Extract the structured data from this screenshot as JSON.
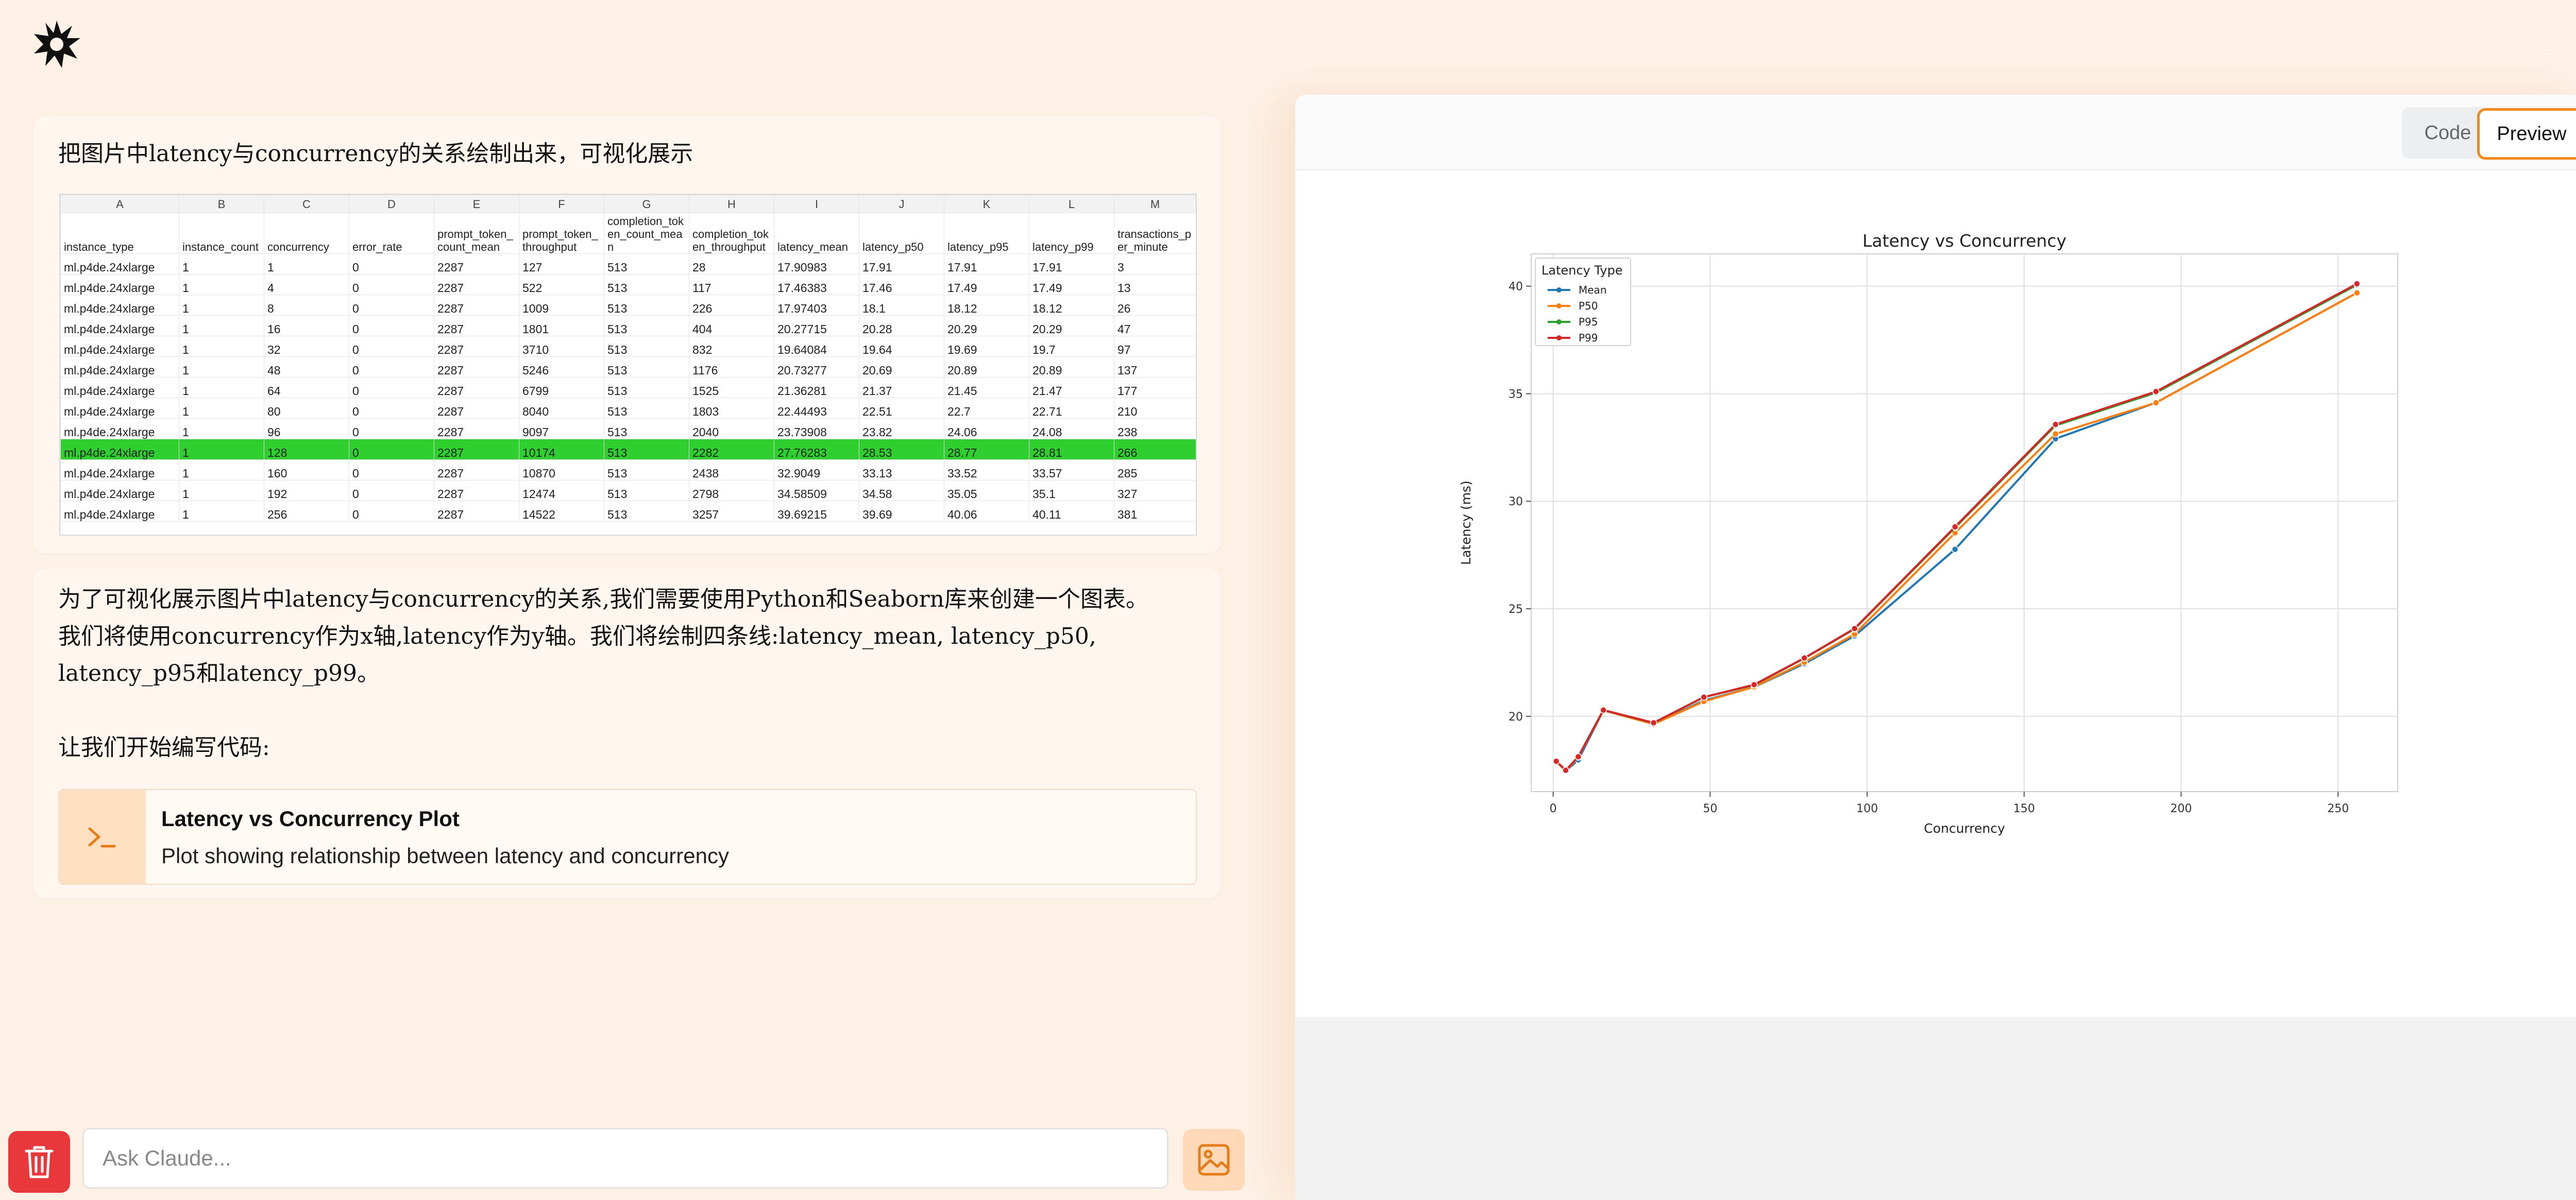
{
  "user": {
    "message": "把图片中latency与concurrency的关系绘制出来，可视化展示"
  },
  "sheet": {
    "col_letters": [
      "A",
      "B",
      "C",
      "D",
      "E",
      "F",
      "G",
      "H",
      "I",
      "J",
      "K",
      "L",
      "M"
    ],
    "headers": [
      "instance_type",
      "instance_count",
      "concurrency",
      "error_rate",
      "prompt_token_count_mean",
      "prompt_token_throughput",
      "completion_token_count_mean",
      "completion_token_throughput",
      "latency_mean",
      "latency_p50",
      "latency_p95",
      "latency_p99",
      "transactions_per_minute"
    ],
    "rows": [
      [
        "ml.p4de.24xlarge",
        "1",
        "1",
        "0",
        "2287",
        "127",
        "513",
        "28",
        "17.90983",
        "17.91",
        "17.91",
        "17.91",
        "3"
      ],
      [
        "ml.p4de.24xlarge",
        "1",
        "4",
        "0",
        "2287",
        "522",
        "513",
        "117",
        "17.46383",
        "17.46",
        "17.49",
        "17.49",
        "13"
      ],
      [
        "ml.p4de.24xlarge",
        "1",
        "8",
        "0",
        "2287",
        "1009",
        "513",
        "226",
        "17.97403",
        "18.1",
        "18.12",
        "18.12",
        "26"
      ],
      [
        "ml.p4de.24xlarge",
        "1",
        "16",
        "0",
        "2287",
        "1801",
        "513",
        "404",
        "20.27715",
        "20.28",
        "20.29",
        "20.29",
        "47"
      ],
      [
        "ml.p4de.24xlarge",
        "1",
        "32",
        "0",
        "2287",
        "3710",
        "513",
        "832",
        "19.64084",
        "19.64",
        "19.69",
        "19.7",
        "97"
      ],
      [
        "ml.p4de.24xlarge",
        "1",
        "48",
        "0",
        "2287",
        "5246",
        "513",
        "1176",
        "20.73277",
        "20.69",
        "20.89",
        "20.89",
        "137"
      ],
      [
        "ml.p4de.24xlarge",
        "1",
        "64",
        "0",
        "2287",
        "6799",
        "513",
        "1525",
        "21.36281",
        "21.37",
        "21.45",
        "21.47",
        "177"
      ],
      [
        "ml.p4de.24xlarge",
        "1",
        "80",
        "0",
        "2287",
        "8040",
        "513",
        "1803",
        "22.44493",
        "22.51",
        "22.7",
        "22.71",
        "210"
      ],
      [
        "ml.p4de.24xlarge",
        "1",
        "96",
        "0",
        "2287",
        "9097",
        "513",
        "2040",
        "23.73908",
        "23.82",
        "24.06",
        "24.08",
        "238"
      ],
      [
        "ml.p4de.24xlarge",
        "1",
        "128",
        "0",
        "2287",
        "10174",
        "513",
        "2282",
        "27.76283",
        "28.53",
        "28.77",
        "28.81",
        "266"
      ],
      [
        "ml.p4de.24xlarge",
        "1",
        "160",
        "0",
        "2287",
        "10870",
        "513",
        "2438",
        "32.9049",
        "33.13",
        "33.52",
        "33.57",
        "285"
      ],
      [
        "ml.p4de.24xlarge",
        "1",
        "192",
        "0",
        "2287",
        "12474",
        "513",
        "2798",
        "34.58509",
        "34.58",
        "35.05",
        "35.1",
        "327"
      ],
      [
        "ml.p4de.24xlarge",
        "1",
        "256",
        "0",
        "2287",
        "14522",
        "513",
        "3257",
        "39.69215",
        "39.69",
        "40.06",
        "40.11",
        "381"
      ]
    ],
    "highlight_color": "#2fcf2f"
  },
  "assistant": {
    "line1": "为了可视化展示图片中latency与concurrency的关系,我们需要使用Python和Seaborn库来创建一个图表。",
    "line2": "我们将使用concurrency作为x轴,latency作为y轴。我们将绘制四条线:latency_mean, latency_p50,",
    "line3": "latency_p95和latency_p99。",
    "line4": "让我们开始编写代码:",
    "artifact": {
      "title": "Latency vs Concurrency Plot",
      "subtitle": "Plot showing relationship between latency and concurrency",
      "icon": "terminal-icon"
    }
  },
  "input": {
    "placeholder": "Ask Claude..."
  },
  "panel": {
    "tab_code": "Code",
    "tab_preview": "Preview",
    "active_tab": "Preview"
  },
  "colors": {
    "accent": "#f08a1c",
    "delete": "#e8383b",
    "background": "#fdf1e6"
  },
  "chart_data": {
    "type": "line",
    "title": "Latency vs Concurrency",
    "xlabel": "Concurrency",
    "ylabel": "Latency (ms)",
    "legend_title": "Latency Type",
    "legend_position": "top-left",
    "grid": true,
    "xlim": [
      -7,
      269
    ],
    "ylim": [
      16.5,
      41.5
    ],
    "xticks": [
      0,
      50,
      100,
      150,
      200,
      250
    ],
    "yticks": [
      20,
      25,
      30,
      35,
      40
    ],
    "x": [
      1,
      4,
      8,
      16,
      32,
      48,
      64,
      80,
      96,
      128,
      160,
      192,
      256
    ],
    "series": [
      {
        "name": "Mean",
        "color": "#1f77b4",
        "values": [
          17.90983,
          17.46383,
          17.97403,
          20.27715,
          19.64084,
          20.73277,
          21.36281,
          22.44493,
          23.73908,
          27.76283,
          32.9049,
          34.58509,
          39.69215
        ]
      },
      {
        "name": "P50",
        "color": "#ff7f0e",
        "values": [
          17.91,
          17.46,
          18.1,
          20.28,
          19.64,
          20.69,
          21.37,
          22.51,
          23.82,
          28.53,
          33.13,
          34.58,
          39.69
        ]
      },
      {
        "name": "P95",
        "color": "#2ca02c",
        "values": [
          17.91,
          17.49,
          18.12,
          20.29,
          19.69,
          20.89,
          21.45,
          22.7,
          24.06,
          28.77,
          33.52,
          35.05,
          40.06
        ]
      },
      {
        "name": "P99",
        "color": "#d62728",
        "values": [
          17.91,
          17.49,
          18.12,
          20.29,
          19.7,
          20.89,
          21.47,
          22.71,
          24.08,
          28.81,
          33.57,
          35.1,
          40.11
        ]
      }
    ]
  }
}
